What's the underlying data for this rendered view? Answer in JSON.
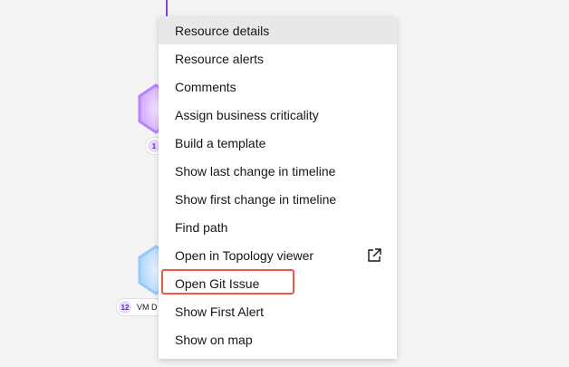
{
  "canvas": {
    "node_top": {
      "count": "1"
    },
    "node_bottom": {
      "count": "12",
      "label": "VM D"
    }
  },
  "context_menu": {
    "items": [
      {
        "label": "Resource details",
        "state": "hover"
      },
      {
        "label": "Resource alerts"
      },
      {
        "label": "Comments"
      },
      {
        "label": "Assign business criticality"
      },
      {
        "label": "Build a template"
      },
      {
        "label": "Show last change in timeline"
      },
      {
        "label": "Show first change in timeline"
      },
      {
        "label": "Find path"
      },
      {
        "label": "Open in Topology viewer",
        "icon": "external-link-icon"
      },
      {
        "label": "Open Git Issue",
        "highlighted": true,
        "highlight_color": "#ef5b3f"
      },
      {
        "label": "Show First Alert"
      },
      {
        "label": "Show on map"
      }
    ]
  },
  "colors": {
    "accent_purple": "#8a3ffc",
    "highlight": "#ef5b3f"
  }
}
